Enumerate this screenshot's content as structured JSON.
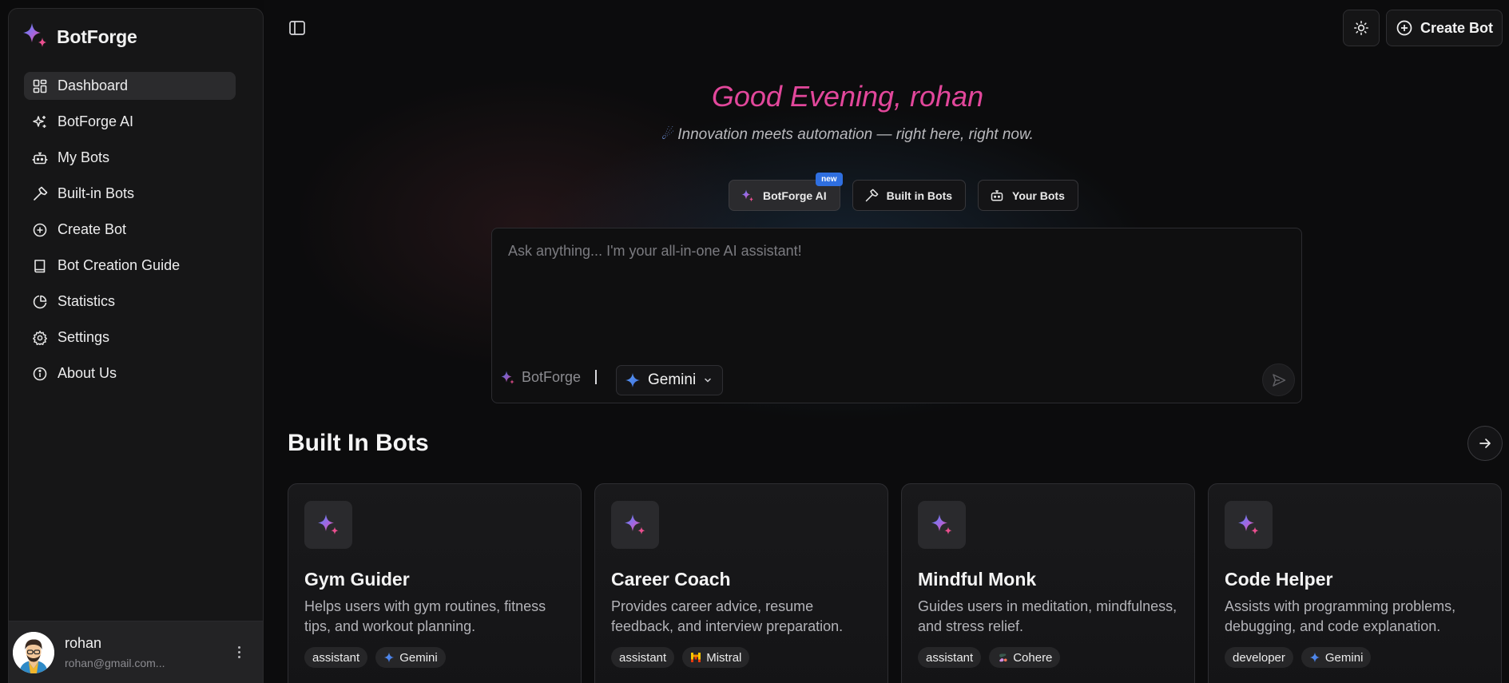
{
  "brand": {
    "name": "BotForge"
  },
  "sidebar": {
    "items": [
      {
        "label": "Dashboard",
        "icon": "dashboard-icon",
        "active": true
      },
      {
        "label": "BotForge AI",
        "icon": "sparkles-icon"
      },
      {
        "label": "My Bots",
        "icon": "bot-icon"
      },
      {
        "label": "Built-in Bots",
        "icon": "hammer-icon"
      },
      {
        "label": "Create Bot",
        "icon": "plus-circle-icon"
      },
      {
        "label": "Bot Creation Guide",
        "icon": "book-icon"
      },
      {
        "label": "Statistics",
        "icon": "pie-chart-icon"
      },
      {
        "label": "Settings",
        "icon": "gear-icon"
      },
      {
        "label": "About Us",
        "icon": "info-icon"
      }
    ],
    "user": {
      "name": "rohan",
      "email": "rohan@gmail.com..."
    }
  },
  "header": {
    "create_label": "Create Bot"
  },
  "hero": {
    "greeting": "Good Evening, rohan",
    "tagline": "Innovation meets automation — right here, right now."
  },
  "modes": [
    {
      "label": "BotForge AI",
      "badge": "new",
      "active": true
    },
    {
      "label": "Built in Bots"
    },
    {
      "label": "Your Bots"
    }
  ],
  "chat": {
    "placeholder": "Ask anything... I'm your all-in-one AI assistant!",
    "brand_label": "BotForge",
    "model": "Gemini"
  },
  "built_in": {
    "title": "Built In Bots",
    "cards": [
      {
        "title": "Gym Guider",
        "desc": "Helps users with gym routines, fitness tips, and workout planning.",
        "tag": "assistant",
        "model": "Gemini",
        "model_icon": "gemini"
      },
      {
        "title": "Career Coach",
        "desc": "Provides career advice, resume feedback, and interview preparation.",
        "tag": "assistant",
        "model": "Mistral",
        "model_icon": "mistral"
      },
      {
        "title": "Mindful Monk",
        "desc": "Guides users in meditation, mindfulness, and stress relief.",
        "tag": "assistant",
        "model": "Cohere",
        "model_icon": "cohere"
      },
      {
        "title": "Code Helper",
        "desc": "Assists with programming problems, debugging, and code explanation.",
        "tag": "developer",
        "model": "Gemini",
        "model_icon": "gemini"
      }
    ]
  },
  "colors": {
    "accent_pink": "#e2479b",
    "badge_blue": "#2f6fe0",
    "gemini_blue": "#4f86f7"
  }
}
